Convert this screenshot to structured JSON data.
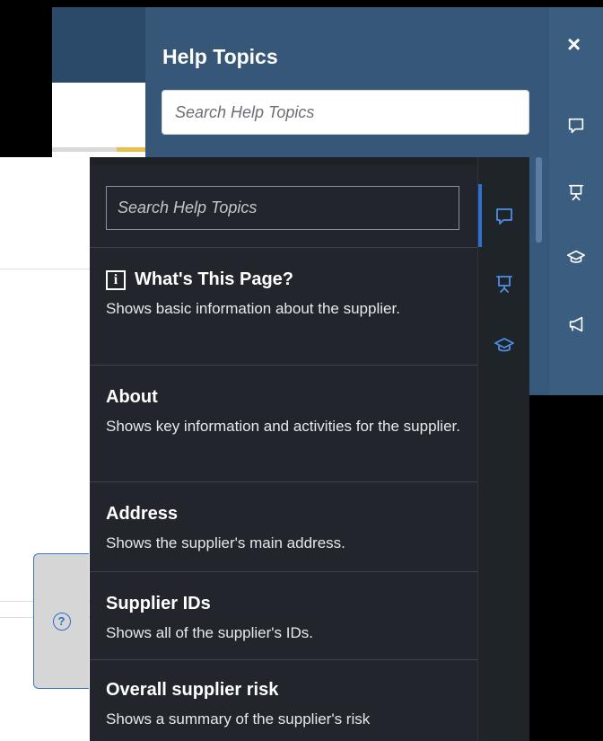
{
  "back_panel": {
    "title": "Help Topics",
    "search_placeholder": "Search Help Topics",
    "close_label": "×",
    "rail_icons": [
      "comment-icon",
      "presentation-icon",
      "graduation-cap-icon",
      "megaphone-icon"
    ]
  },
  "front_panel": {
    "search_placeholder": "Search Help Topics",
    "topics": [
      {
        "title": "What's This Page?",
        "description": "Shows basic information about the supplier.",
        "icon": "info-icon"
      },
      {
        "title": "About",
        "description": "Shows key information and activities for the supplier."
      },
      {
        "title": "Address",
        "description": "Shows the supplier's main address."
      },
      {
        "title": "Supplier IDs",
        "description": "Shows all of the supplier's IDs."
      },
      {
        "title": "Overall supplier risk",
        "description": "Shows a summary of the supplier's risk"
      }
    ],
    "rail_icons": [
      "comment-icon",
      "presentation-icon",
      "graduation-cap-icon"
    ]
  },
  "help_fab": {
    "label": "?"
  },
  "colors": {
    "back_panel_bg": "#375778",
    "front_panel_bg": "#22262c",
    "accent_blue": "#2e6fd1"
  }
}
